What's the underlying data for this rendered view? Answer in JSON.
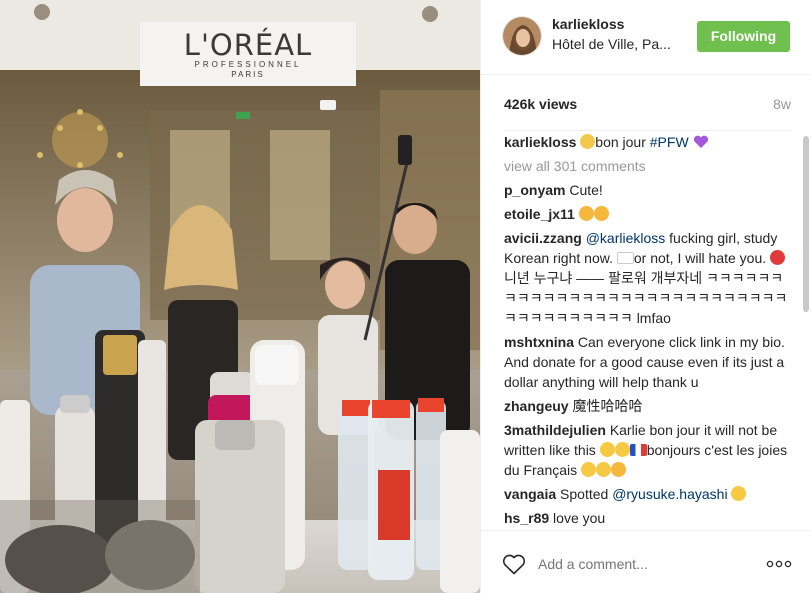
{
  "media": {
    "logo_brand": "L'ORÉAL",
    "logo_sub": "PROFESSIONNEL",
    "logo_city": "PARIS"
  },
  "header": {
    "username": "karliekloss",
    "location": "Hôtel de Ville, Pa...",
    "follow_label": "Following",
    "follow_color": "#70c050"
  },
  "stats": {
    "views": "426k views",
    "age": "8w"
  },
  "caption": {
    "username": "karliekloss",
    "text_before": "bon jour ",
    "hashtag": "#PFW",
    "emoji_icons": [
      "blonde-woman-emoji-icon",
      "purple-heart-emoji-icon"
    ]
  },
  "view_all": "view all 301 comments",
  "comments": [
    {
      "username": "p_onyam",
      "parts": [
        {
          "t": "text",
          "v": "Cute!"
        }
      ]
    },
    {
      "username": "etoile_jx11",
      "parts": [
        {
          "t": "emoji",
          "v": "kiss-face-emoji-icon"
        },
        {
          "t": "emoji",
          "v": "kiss-face-emoji-icon"
        }
      ]
    },
    {
      "username": "avicii.zzang",
      "parts": [
        {
          "t": "mention",
          "v": "@karliekloss"
        },
        {
          "t": "text",
          "v": " fucking girl, study Korean right now. "
        },
        {
          "t": "emoji",
          "v": "korea-flag-emoji-icon"
        },
        {
          "t": "text",
          "v": "or not, I will hate you. "
        },
        {
          "t": "emoji",
          "v": "no-entry-emoji-icon"
        },
        {
          "t": "text",
          "v": "니년 누구냐 —— 팔로워 개부자네 ㅋㅋㅋㅋㅋㅋㅋㅋㅋㅋㅋㅋㅋㅋㅋㅋㅋㅋㅋㅋㅋㅋㅋㅋㅋㅋㅋㅋㅋㅋㅋㅋㅋㅋㅋㅋㅋㅋ lmfao"
        }
      ]
    },
    {
      "username": "mshtxnina",
      "parts": [
        {
          "t": "text",
          "v": "Can everyone click link in my bio. And donate for a good cause even if its just a dollar anything will help thank u"
        }
      ]
    },
    {
      "username": "zhangeuy",
      "parts": [
        {
          "t": "text",
          "v": "魔性哈哈哈"
        }
      ]
    },
    {
      "username": "3mathildejulien",
      "parts": [
        {
          "t": "text",
          "v": "Karlie bon jour it will not be written like this "
        },
        {
          "t": "emoji",
          "v": "laughing-emoji-icon"
        },
        {
          "t": "emoji",
          "v": "laughing-emoji-icon"
        },
        {
          "t": "emoji",
          "v": "france-flag-emoji-icon"
        },
        {
          "t": "text",
          "v": "bonjours c'est les joies du Français "
        },
        {
          "t": "emoji",
          "v": "laughing-emoji-icon"
        },
        {
          "t": "emoji",
          "v": "laughing-emoji-icon"
        },
        {
          "t": "emoji",
          "v": "kiss-face-emoji-icon"
        }
      ]
    },
    {
      "username": "vangaia",
      "parts": [
        {
          "t": "text",
          "v": "Spotted "
        },
        {
          "t": "mention",
          "v": "@ryusuke.hayashi"
        },
        {
          "t": "text",
          "v": " "
        },
        {
          "t": "emoji",
          "v": "laughing-emoji-icon"
        }
      ]
    },
    {
      "username": "hs_r89",
      "parts": [
        {
          "t": "text",
          "v": "love you"
        }
      ]
    }
  ],
  "footer": {
    "add_comment_placeholder": "Add a comment...",
    "like_icon": "heart-outline-icon",
    "more_icon": "more-options-icon"
  },
  "colors": {
    "accent": "#70c050",
    "link": "#003569",
    "muted": "#999999",
    "border": "#efefef"
  }
}
